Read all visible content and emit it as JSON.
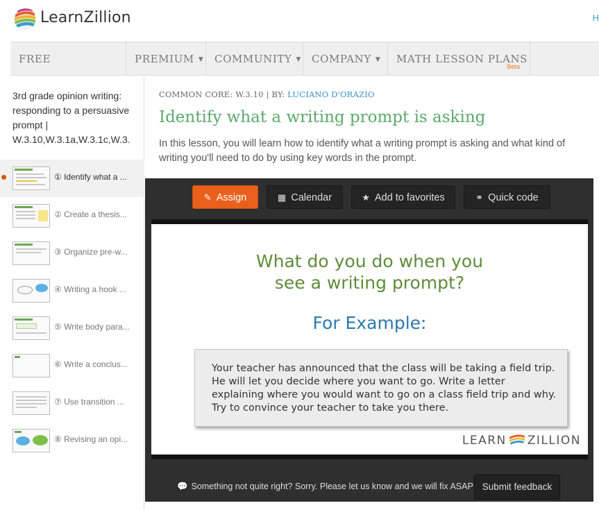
{
  "header": {
    "logo_text": "LearnZillion",
    "right_text": "H"
  },
  "nav": {
    "items": [
      {
        "label": "FREE RESOURCES",
        "caret": false
      },
      {
        "label": "PREMIUM",
        "caret": true
      },
      {
        "label": "COMMUNITY",
        "caret": true
      },
      {
        "label": "COMPANY",
        "caret": true
      },
      {
        "label": "MATH LESSON PLANS",
        "caret": false
      }
    ],
    "beta_label": "Beta",
    "caret_glyph": "▼"
  },
  "sidebar": {
    "title": "3rd grade opinion writing: responding to a persuasive prompt | W.3.10,W.3.1a,W.3.1c,W.3.",
    "lessons": [
      {
        "label": "① Identify what a ...",
        "active": true
      },
      {
        "label": "② Create a thesis...",
        "active": false
      },
      {
        "label": "③ Organize pre-w...",
        "active": false
      },
      {
        "label": "④ Writing a hook ...",
        "active": false
      },
      {
        "label": "⑤ Write body para...",
        "active": false
      },
      {
        "label": "⑥ Write a conclus...",
        "active": false
      },
      {
        "label": "⑦ Use transition ...",
        "active": false
      },
      {
        "label": "⑧ Revising an opi...",
        "active": false
      }
    ]
  },
  "main": {
    "meta_prefix": "COMMON CORE: W.3.10 | BY:",
    "author": "LUCIANO D'ORAZIO",
    "title": "Identify what a writing prompt is asking",
    "description": "In this lesson, you will learn how to identify what a writing prompt is asking and what kind of writing you'll need to do by using key words in the prompt."
  },
  "toolbar": {
    "assign": "Assign",
    "calendar": "Calendar",
    "favorites": "Add to favorites",
    "quick_code": "Quick code"
  },
  "slide": {
    "question_line1": "What do you do when you",
    "question_line2": "see a writing prompt?",
    "example_heading": "For Example:",
    "prompt_text": "Your teacher has announced that the class will be taking a field trip. He will let you decide where you want to go. Write a letter explaining where you would want to go on a class field trip and why. Try to convince your teacher to take you there.",
    "logo_left": "LEARN",
    "logo_right": "ZILLION"
  },
  "feedback": {
    "message": "Something not quite right? Sorry. Please let us know and we will fix ASAP!",
    "button": "Submit feedback"
  },
  "colors": {
    "accent_orange": "#e8601c",
    "title_green": "#5aa96a",
    "link_blue": "#3a8fc4",
    "player_bg": "#2f2f2f"
  }
}
